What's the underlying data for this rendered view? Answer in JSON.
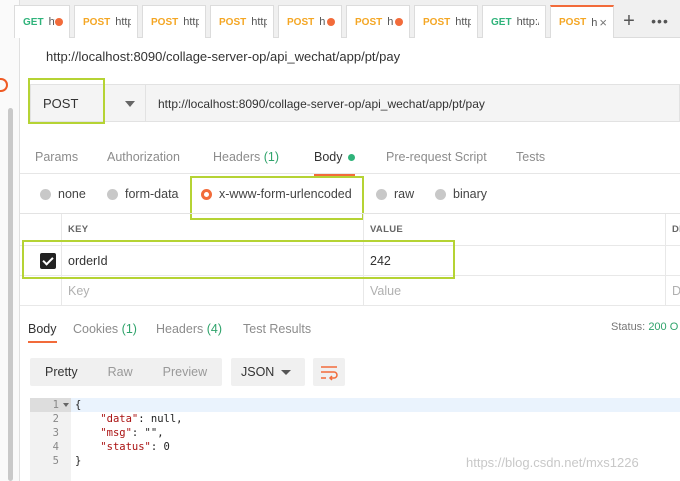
{
  "tabs": [
    {
      "method": "GET",
      "url": "ht",
      "dirty": true
    },
    {
      "method": "POST",
      "url": "http",
      "dirty": false
    },
    {
      "method": "POST",
      "url": "http",
      "dirty": false
    },
    {
      "method": "POST",
      "url": "http",
      "dirty": false
    },
    {
      "method": "POST",
      "url": "h",
      "dirty": true
    },
    {
      "method": "POST",
      "url": "h",
      "dirty": true
    },
    {
      "method": "POST",
      "url": "http",
      "dirty": false
    },
    {
      "method": "GET",
      "url": "http:/",
      "dirty": false
    },
    {
      "method": "POST",
      "url": "h",
      "dirty": false
    }
  ],
  "request": {
    "title": "http://localhost:8090/collage-server-op/api_wechat/app/pt/pay",
    "method": "POST",
    "url": "http://localhost:8090/collage-server-op/api_wechat/app/pt/pay"
  },
  "request_tabs": {
    "params": "Params",
    "authorization": "Authorization",
    "headers": "Headers",
    "headers_count": "(1)",
    "body": "Body",
    "pre_request": "Pre-request Script",
    "tests": "Tests"
  },
  "body_modes": {
    "none": "none",
    "form_data": "form-data",
    "urlencoded": "x-www-form-urlencoded",
    "raw": "raw",
    "binary": "binary"
  },
  "kv_table": {
    "key_header": "KEY",
    "value_header": "VALUE",
    "desc_header": "DE",
    "rows": [
      {
        "key": "orderId",
        "value": "242",
        "checked": true
      }
    ],
    "key_placeholder": "Key",
    "value_placeholder": "Value",
    "desc_placeholder": "D"
  },
  "response": {
    "tabs": {
      "body": "Body",
      "cookies": "Cookies",
      "cookies_count": "(1)",
      "headers": "Headers",
      "headers_count": "(4)",
      "test_results": "Test Results"
    },
    "status_label": "Status:",
    "status_value": "200 O",
    "view_tabs": {
      "pretty": "Pretty",
      "raw": "Raw",
      "preview": "Preview"
    },
    "format": "JSON",
    "lines": [
      {
        "n": "1",
        "text": "{"
      },
      {
        "n": "2",
        "key": "\"data\"",
        "rest": ": null,"
      },
      {
        "n": "3",
        "key": "\"msg\"",
        "rest": ": \"\","
      },
      {
        "n": "4",
        "key": "\"status\"",
        "rest": ": 0"
      },
      {
        "n": "5",
        "text": "}"
      }
    ]
  },
  "watermark": "https://blog.csdn.net/mxs1226",
  "colors": {
    "accent": "#f26b3a",
    "highlight": "#b5d334",
    "get": "#2fb37a",
    "post": "#f4a623"
  }
}
